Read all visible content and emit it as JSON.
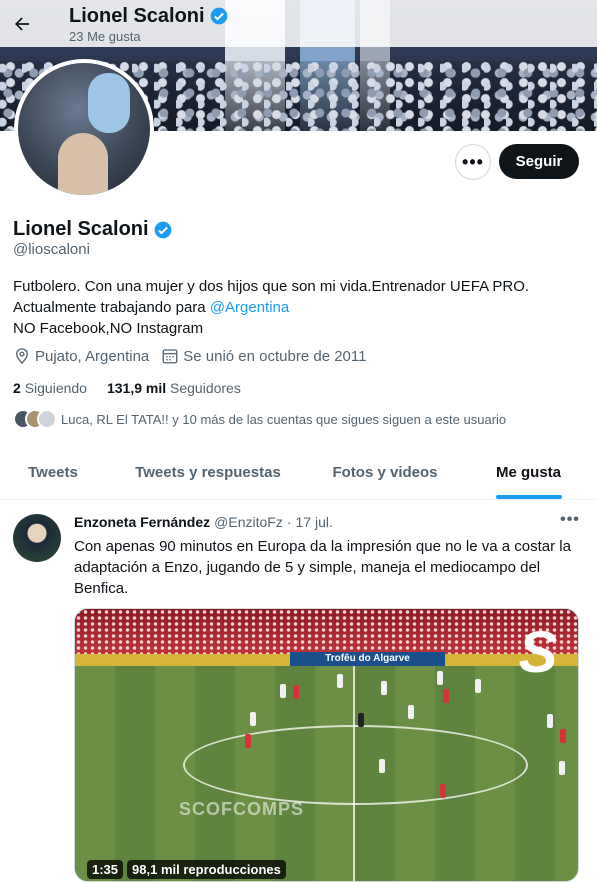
{
  "header": {
    "name": "Lionel Scaloni",
    "likes_count": "23 Me gusta"
  },
  "profile": {
    "name": "Lionel Scaloni",
    "handle": "@lioscaloni",
    "bio_line1": "Futbolero. Con una mujer y dos hijos que son mi vida.Entrenador UEFA PRO.",
    "bio_line2_prefix": "Actualmente trabajando para ",
    "bio_link": "@Argentina",
    "bio_line3": "NO Facebook,NO Instagram",
    "location": "Pujato, Argentina",
    "joined": "Se unió en octubre de 2011",
    "following_count": "2",
    "following_label": "Siguiendo",
    "followers_count": "131,9 mil",
    "followers_label": "Seguidores",
    "known_followers": "Luca, RL El TATA!! y 10 más de las cuentas que sigues siguen a este usuario",
    "follow_button": "Seguir",
    "more_button": "•••"
  },
  "tabs": [
    {
      "label": "Tweets",
      "active": false
    },
    {
      "label": "Tweets y respuestas",
      "active": false
    },
    {
      "label": "Fotos y videos",
      "active": false
    },
    {
      "label": "Me gusta",
      "active": true
    }
  ],
  "tweet": {
    "author": "Enzoneta Fernández",
    "handle": "@EnzitoFz",
    "separator": "·",
    "date": "17 jul.",
    "more": "•••",
    "text": "Con apenas 90 minutos en Europa da la impresión que no le va a costar la adaptación a Enzo, jugando de 5 y simple, maneja el mediocampo del Benfica.",
    "media": {
      "board_text": "Trofêu do Algarve",
      "watermark": "SCOFCOMPS",
      "logo": "S",
      "duration": "1:35",
      "views": "98,1 mil reproducciones"
    }
  },
  "colors": {
    "accent": "#1d9bf0",
    "text": "#0f1419",
    "secondary": "#536471",
    "follow_bg": "#0f1419"
  }
}
